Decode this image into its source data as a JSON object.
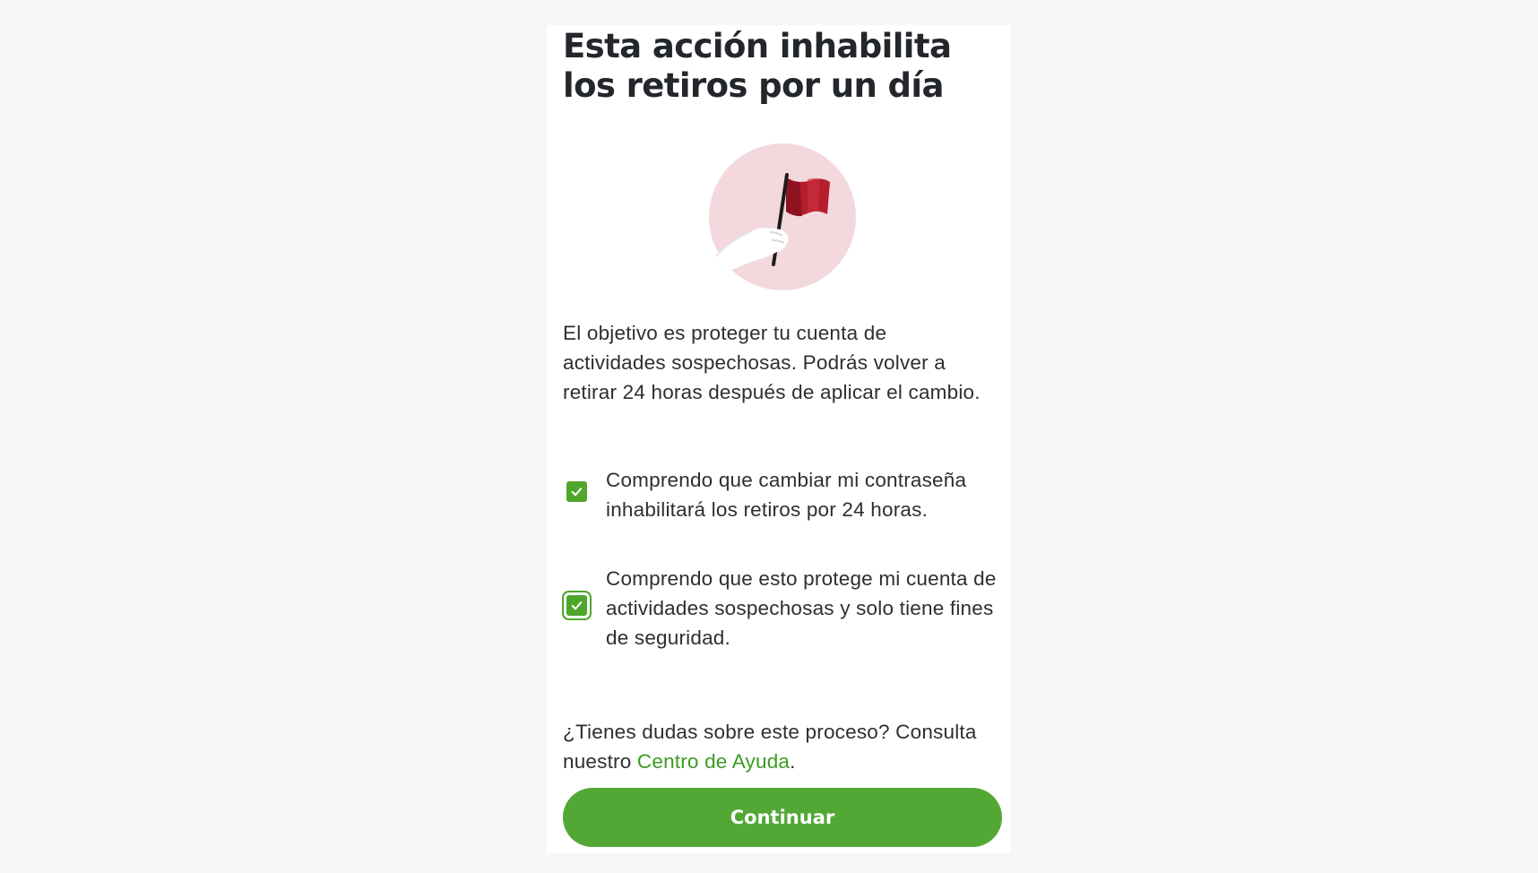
{
  "modal": {
    "title": "Esta acción inhabilita los retiros por un día",
    "illustration": "red-flag-icon",
    "body": "El objetivo es proteger tu cuenta de actividades sospechosas. Podrás volver a retirar 24 horas después de aplicar el cambio.",
    "checkboxes": [
      {
        "label": "Comprendo que cambiar mi contraseña inhabilitará los retiros por 24 horas.",
        "checked": true
      },
      {
        "label": "Comprendo que esto protege mi cuenta de actividades sospechosas y solo tiene fines de seguridad.",
        "checked": true
      }
    ],
    "help": {
      "text_before": "¿Tienes dudas sobre este proceso? Consulta nuestro ",
      "link_label": "Centro de Ayuda",
      "text_after": "."
    },
    "continue_label": "Continuar"
  },
  "colors": {
    "accent_green": "#53a835",
    "flag_red": "#b41e2d",
    "circle_pink": "#f3d9de",
    "background": "#f7f7f9"
  }
}
